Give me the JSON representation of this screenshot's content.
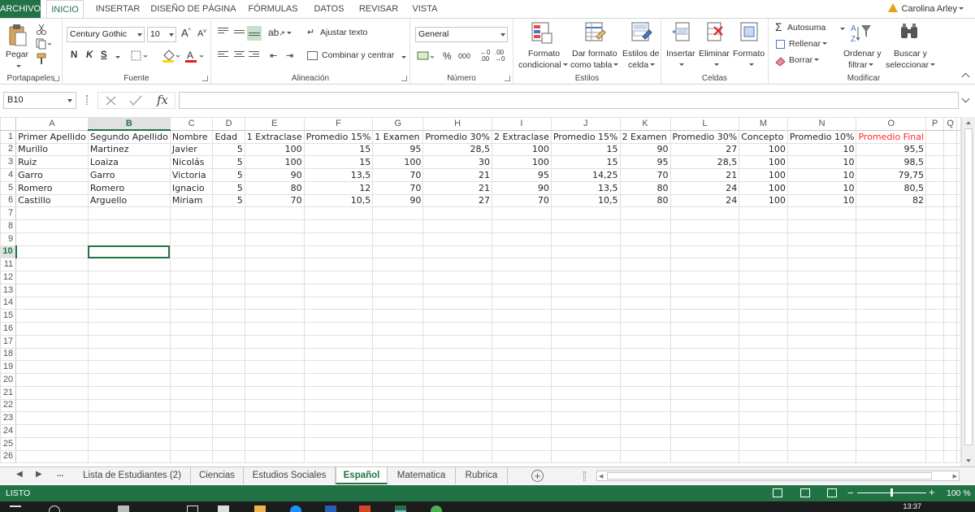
{
  "ribbon_tabs": [
    "ARCHIVO",
    "INICIO",
    "INSERTAR",
    "DISEÑO DE PÁGINA",
    "FÓRMULAS",
    "DATOS",
    "REVISAR",
    "VISTA"
  ],
  "user": "Carolina Arley",
  "clipboard": {
    "paste": "Pegar",
    "group": "Portapapeles"
  },
  "font": {
    "name": "Century Gothic",
    "size": "10",
    "bold": "N",
    "italic": "K",
    "underline": "S",
    "group": "Fuente"
  },
  "alignment": {
    "wrap": "Ajustar texto",
    "merge": "Combinar y centrar",
    "group": "Alineación"
  },
  "number": {
    "format": "General",
    "percent": "%",
    "thousands": "000",
    "group": "Número"
  },
  "styles": {
    "conditional": [
      "Formato",
      "condicional"
    ],
    "as_table": [
      "Dar formato",
      "como tabla"
    ],
    "cell_styles": [
      "Estilos de",
      "celda"
    ],
    "group": "Estilos"
  },
  "cells": {
    "insert": "Insertar",
    "delete": "Eliminar",
    "format": "Formato",
    "group": "Celdas"
  },
  "editing": {
    "autosum": "Autosuma",
    "fill": "Rellenar",
    "clear": "Borrar",
    "sort": [
      "Ordenar y",
      "filtrar"
    ],
    "find": [
      "Buscar y",
      "seleccionar"
    ],
    "group": "Modificar"
  },
  "formula_bar": {
    "name_box": "B10",
    "fx": "fx",
    "value": ""
  },
  "grid": {
    "columns": [
      "A",
      "B",
      "C",
      "D",
      "E",
      "F",
      "G",
      "H",
      "I",
      "J",
      "K",
      "L",
      "M",
      "N",
      "O",
      "P",
      "Q"
    ],
    "selected_column": "B",
    "selected_row": 10,
    "row_count": 26,
    "rows": [
      [
        "Primer Apellido",
        "Segundo Apellido",
        "Nombre",
        "Edad",
        "1 Extraclase",
        "Promedio 15%",
        "1 Examen",
        "Promedio 30%",
        "2 Extraclase",
        "Promedio 15%",
        "2 Examen",
        "Promedio 30%",
        "Concepto",
        "Promedio 10%",
        "Promedio Final"
      ],
      [
        "Murillo",
        "Martinez",
        "Javier",
        "5",
        "100",
        "15",
        "95",
        "28,5",
        "100",
        "15",
        "90",
        "27",
        "100",
        "10",
        "95,5"
      ],
      [
        "Ruiz",
        "Loaiza",
        "Nicolás",
        "5",
        "100",
        "15",
        "100",
        "30",
        "100",
        "15",
        "95",
        "28,5",
        "100",
        "10",
        "98,5"
      ],
      [
        "Garro",
        "Garro",
        "Victoria",
        "5",
        "90",
        "13,5",
        "70",
        "21",
        "95",
        "14,25",
        "70",
        "21",
        "100",
        "10",
        "79,75"
      ],
      [
        "Romero",
        "Romero",
        "Ignacio",
        "5",
        "80",
        "12",
        "70",
        "21",
        "90",
        "13,5",
        "80",
        "24",
        "100",
        "10",
        "80,5"
      ],
      [
        "Castillo",
        "Arguello",
        "Miriam",
        "5",
        "70",
        "10,5",
        "90",
        "27",
        "70",
        "10,5",
        "80",
        "24",
        "100",
        "10",
        "82"
      ]
    ]
  },
  "sheet_tabs": [
    "Lista de Estudiantes (2)",
    "Ciencias",
    "Estudios Sociales",
    "Español",
    "Matematica",
    "Rubrica"
  ],
  "active_sheet": "Español",
  "status": {
    "text": "LISTO",
    "zoom": "100 %"
  },
  "taskbar": {
    "clock": "13:37"
  },
  "colors": {
    "accent": "#217346",
    "final_header": "#ff2a2a",
    "grid_line": "#e0e0e0"
  }
}
